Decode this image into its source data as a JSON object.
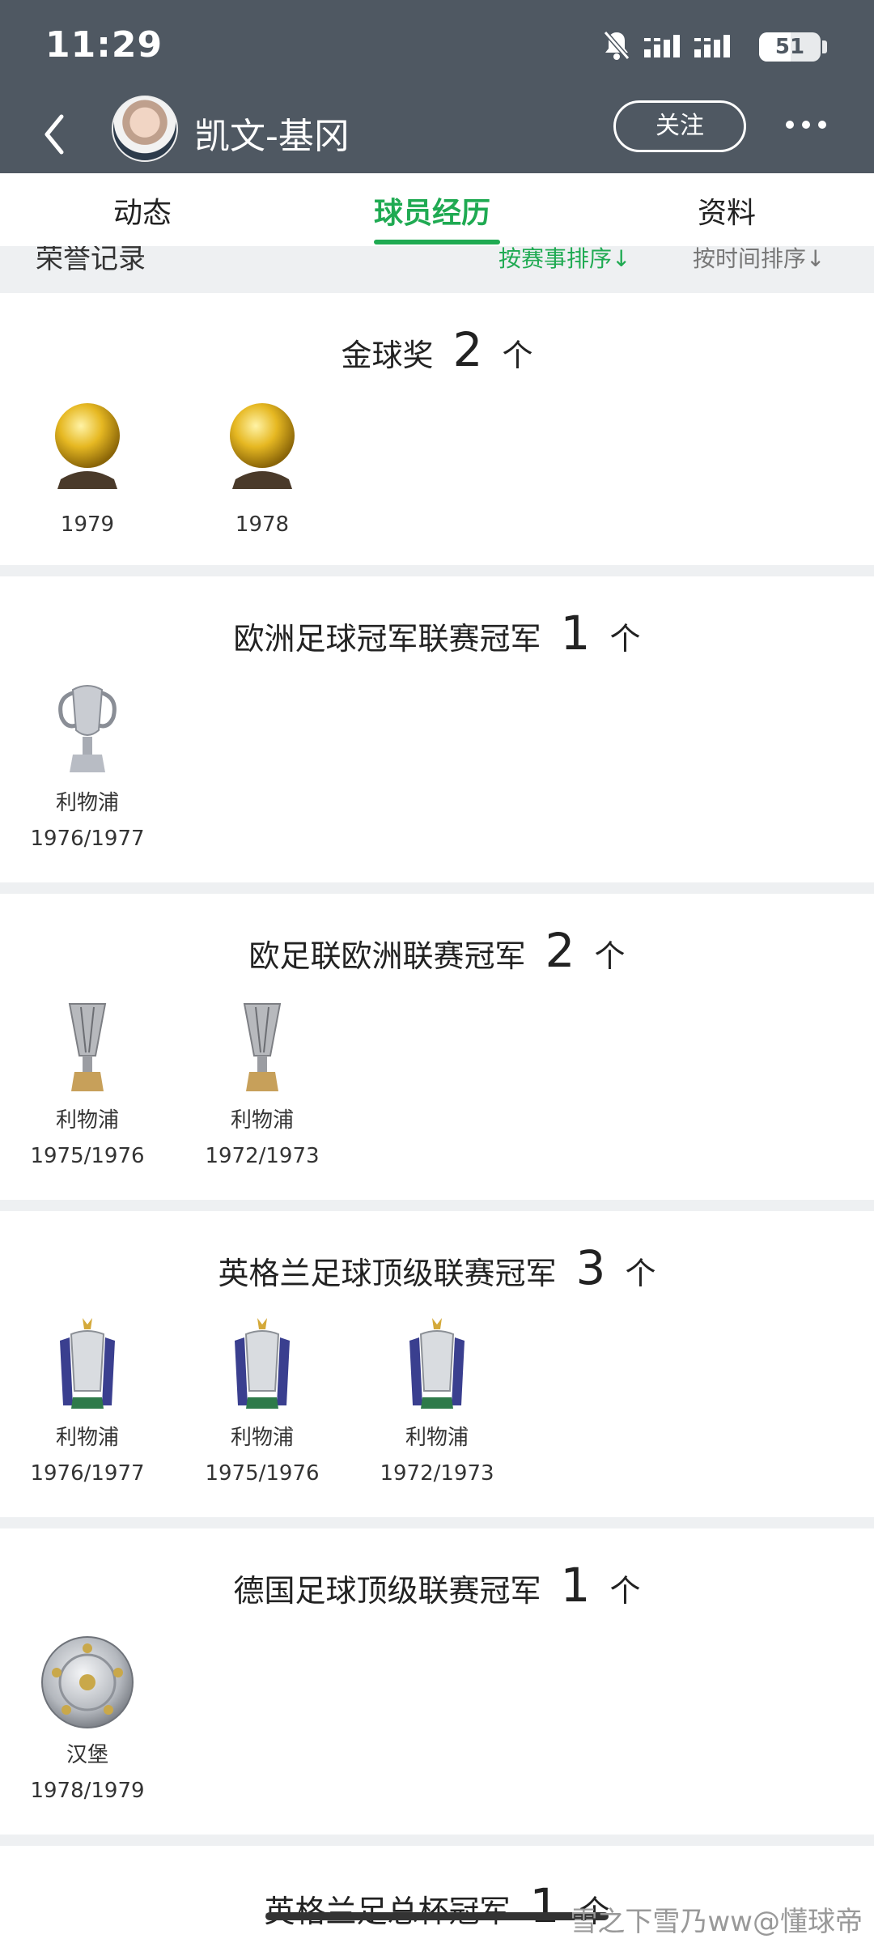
{
  "status_bar": {
    "time": "11:29",
    "battery_level": 51,
    "battery_text": "51"
  },
  "header": {
    "player_name": "凯文-基冈",
    "follow_label": "关注"
  },
  "tabs": [
    {
      "label": "动态"
    },
    {
      "label": "球员经历"
    },
    {
      "label": "资料"
    }
  ],
  "section": {
    "title": "荣誉记录",
    "sort_by_event": "按赛事排序↓",
    "sort_by_time": "按时间排序↓"
  },
  "honors": [
    {
      "name": "金球奖",
      "count": "2",
      "unit": "个",
      "trophies": [
        {
          "club": "",
          "season": "1979"
        },
        {
          "club": "",
          "season": "1978"
        }
      ]
    },
    {
      "name": "欧洲足球冠军联赛冠军",
      "count": "1",
      "unit": "个",
      "trophies": [
        {
          "club": "利物浦",
          "season": "1976/1977"
        }
      ]
    },
    {
      "name": "欧足联欧洲联赛冠军",
      "count": "2",
      "unit": "个",
      "trophies": [
        {
          "club": "利物浦",
          "season": "1975/1976"
        },
        {
          "club": "利物浦",
          "season": "1972/1973"
        }
      ]
    },
    {
      "name": "英格兰足球顶级联赛冠军",
      "count": "3",
      "unit": "个",
      "trophies": [
        {
          "club": "利物浦",
          "season": "1976/1977"
        },
        {
          "club": "利物浦",
          "season": "1975/1976"
        },
        {
          "club": "利物浦",
          "season": "1972/1973"
        }
      ]
    },
    {
      "name": "德国足球顶级联赛冠军",
      "count": "1",
      "unit": "个",
      "trophies": [
        {
          "club": "汉堡",
          "season": "1978/1979"
        }
      ]
    },
    {
      "name": "英格兰足总杯冠军",
      "count": "1",
      "unit": "个",
      "trophies": []
    }
  ],
  "watermark": "雪之下雪乃ww@懂球帝",
  "colors": {
    "header_bg": "#4f5862",
    "accent_green": "#1faa52",
    "page_bg": "#eef0f2"
  },
  "icons": [
    "mute-icon",
    "signal-icon",
    "battery-icon",
    "back-arrow-icon",
    "more-icon",
    "ballon-dor-icon",
    "champions-league-trophy-icon",
    "europa-league-trophy-icon",
    "premier-league-trophy-icon",
    "bundesliga-shield-icon"
  ]
}
